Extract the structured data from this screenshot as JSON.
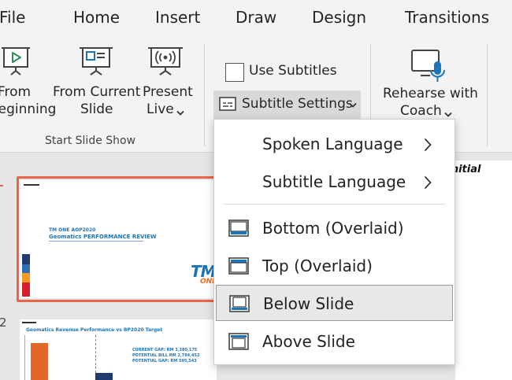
{
  "tabs": [
    "File",
    "Home",
    "Insert",
    "Draw",
    "Design",
    "Transitions"
  ],
  "ribbon": {
    "from_beginning": {
      "line1": "From",
      "line2": "Beginning"
    },
    "from_current": {
      "line1": "From Current",
      "line2": "Slide"
    },
    "present_live": {
      "line1": "Present",
      "line2": "Live"
    },
    "group_start": "Start Slide Show",
    "use_subtitles": "Use Subtitles",
    "subtitle_settings": "Subtitle Settings",
    "rehearse": {
      "line1": "Rehearse with",
      "line2": "Coach"
    }
  },
  "menu": {
    "items": [
      {
        "label": "Spoken Language",
        "submenu": true
      },
      {
        "label": "Subtitle Language",
        "submenu": true
      },
      {
        "label": "Bottom (Overlaid)",
        "icon": "subtitle-bottom-overlaid-icon"
      },
      {
        "label": "Top (Overlaid)",
        "icon": "subtitle-top-overlaid-icon"
      },
      {
        "label": "Below Slide",
        "icon": "subtitle-below-slide-icon",
        "selected": true
      },
      {
        "label": "Above Slide",
        "icon": "subtitle-above-slide-icon"
      }
    ]
  },
  "slides": {
    "slide1": {
      "number": "1",
      "title_line1": "TM ONE AOP2020",
      "title_line2": "Geomatics PERFORMANCE REVIEW",
      "logo_text": "TM",
      "logo_sub": "ONE"
    },
    "slide2": {
      "number": "2",
      "title": "Geomatics Revenue Performance vs BP2020 Target",
      "stat1": "CURRENT GAP: RM 3,380,175",
      "stat2": "POTENTIAL BILL RM 2,784,452",
      "stat3": "POTENTIAL GAP: RM 595,543"
    }
  },
  "doc_peek_text": "Initial",
  "colors": {
    "accent": "#e8654a",
    "tm_blue": "#1b75bb",
    "tm_orange": "#f36f21"
  }
}
